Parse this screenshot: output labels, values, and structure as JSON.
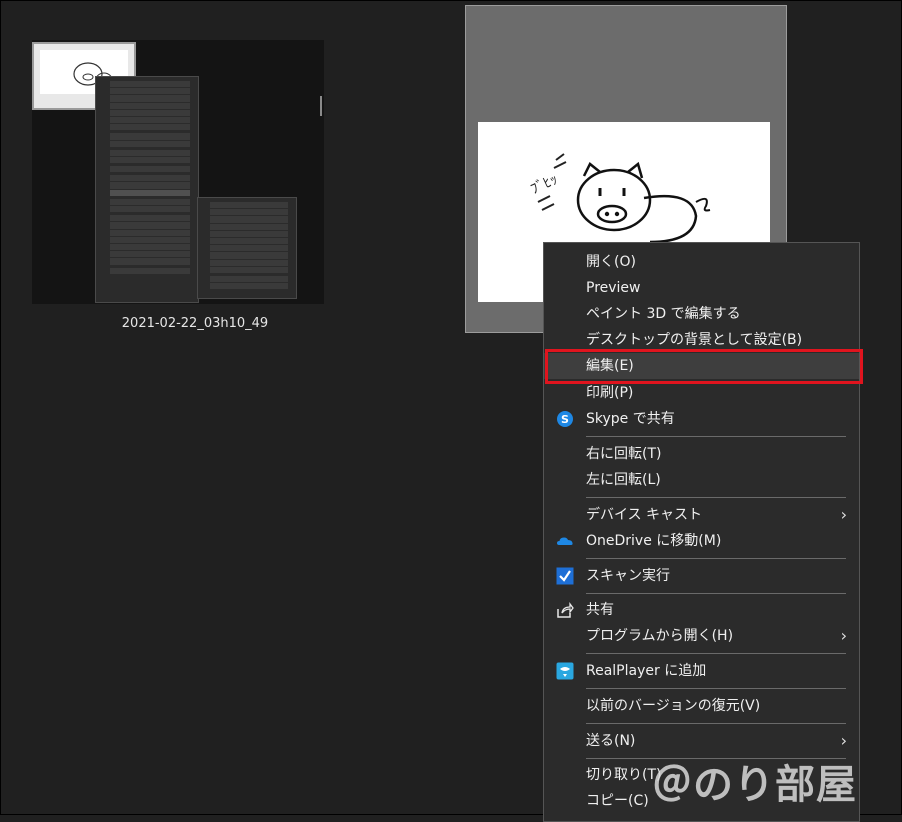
{
  "file_caption": "2021-02-22_03h10_49",
  "watermark": "＠のり部屋",
  "colors": {
    "highlight": "#e0141e",
    "menu_bg": "#2b2b2b",
    "skype": "#1e88e5",
    "onedrive": "#1e88e5",
    "realplayer": "#2aa7e0"
  },
  "context_menu": {
    "items": [
      {
        "label": "開く(O)"
      },
      {
        "label": "Preview"
      },
      {
        "label": "ペイント 3D で編集する"
      },
      {
        "label": "デスクトップの背景として設定(B)"
      },
      {
        "label": "編集(E)",
        "highlighted": true
      },
      {
        "label": "印刷(P)"
      },
      {
        "label": "Skype で共有",
        "icon": "skype-icon"
      },
      {
        "label": "右に回転(T)"
      },
      {
        "label": "左に回転(L)"
      },
      {
        "label": "デバイス キャスト",
        "submenu": true
      },
      {
        "label": "OneDrive に移動(M)",
        "icon": "onedrive-icon"
      },
      {
        "label": "スキャン実行",
        "icon": "scan-icon"
      },
      {
        "label": "共有",
        "icon": "share-icon"
      },
      {
        "label": "プログラムから開く(H)",
        "submenu": true
      },
      {
        "label": "RealPlayer に追加",
        "icon": "realplayer-icon"
      },
      {
        "label": "以前のバージョンの復元(V)"
      },
      {
        "label": "送る(N)",
        "submenu": true
      },
      {
        "label": "切り取り(T)"
      },
      {
        "label": "コピー(C)"
      }
    ],
    "submenu_arrow": "›"
  }
}
